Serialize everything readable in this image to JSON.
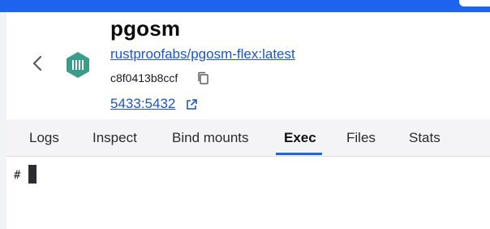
{
  "container": {
    "name": "pgosm",
    "image": "rustproofabs/pgosm-flex:latest",
    "id": "c8f0413b8ccf",
    "ports": "5433:5432"
  },
  "icons": {
    "back": "chevron-left-icon",
    "container": "container-icon",
    "copy": "copy-icon",
    "external": "external-link-icon"
  },
  "tabs": [
    {
      "label": "Logs"
    },
    {
      "label": "Inspect"
    },
    {
      "label": "Bind mounts"
    },
    {
      "label": "Exec",
      "active": true
    },
    {
      "label": "Files"
    },
    {
      "label": "Stats"
    }
  ],
  "terminal": {
    "prompt": "#"
  },
  "colors": {
    "accent": "#1d63ed",
    "link": "#1b55c9",
    "container_icon": "#3b9c8c"
  }
}
